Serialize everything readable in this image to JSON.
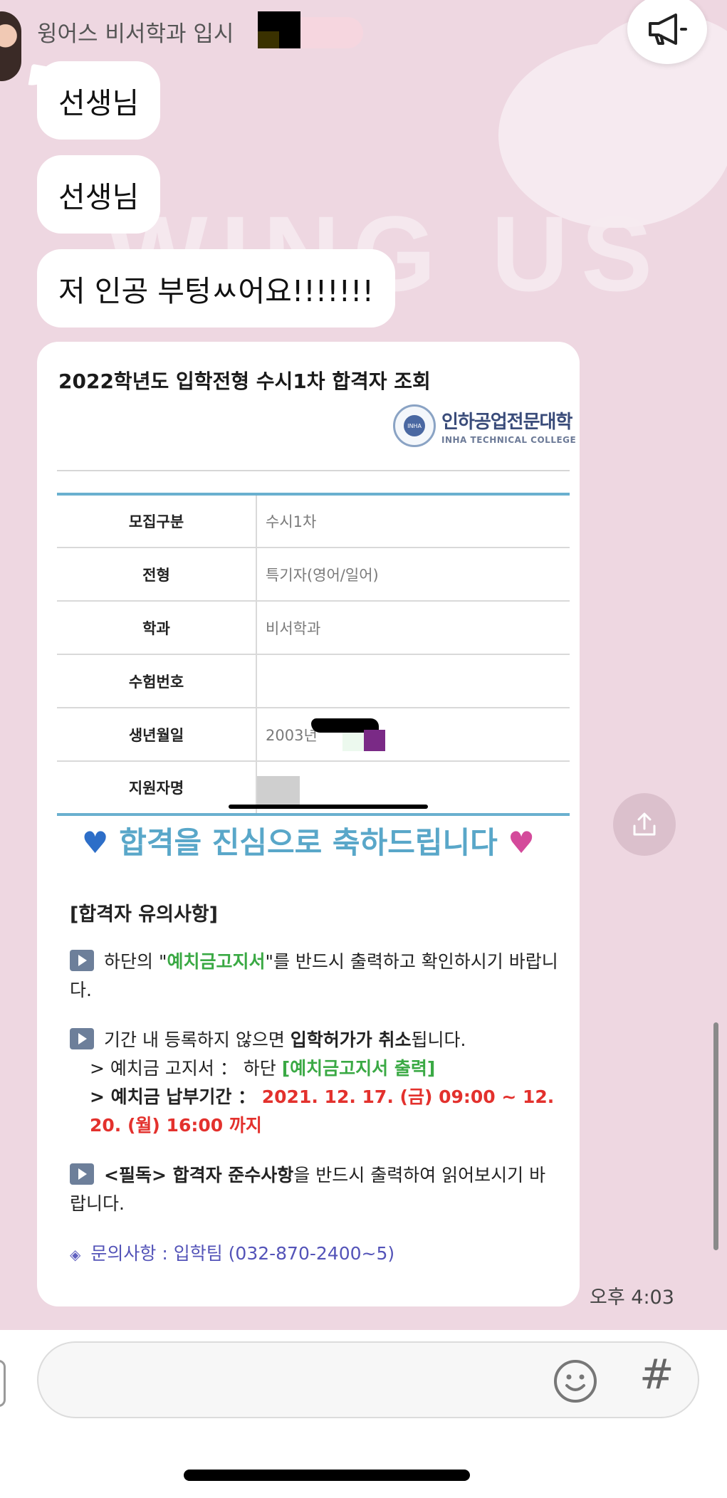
{
  "chat": {
    "sender_name": "윙어스 비서학과 입시",
    "messages": [
      "선생님",
      "선생님",
      "저 인공 부텅ㅆ어요!!!!!!!"
    ],
    "timestamp": "오후 4:03"
  },
  "background_text": "WING US",
  "card": {
    "title": "2022학년도 입학전형 수시1차 합격자 조회",
    "college_ko": "인하공업전문대학",
    "college_en": "INHA TECHNICAL COLLEGE",
    "seal_text": "INHA",
    "rows": [
      {
        "label": "모집구분",
        "value": "수시1차"
      },
      {
        "label": "전형",
        "value": "특기자(영어/일어)"
      },
      {
        "label": "학과",
        "value": "비서학과"
      },
      {
        "label": "수험번호",
        "value": ""
      },
      {
        "label": "생년월일",
        "value": "2003년"
      },
      {
        "label": "지원자명",
        "value": ""
      }
    ],
    "congrats": "합격을 진심으로 축하드립니다",
    "notes_title": "[합격자 유의사항]",
    "note1": {
      "a": "하단의 \"",
      "b": "예치금고지서",
      "c": "\"를 반드시 출력하고 확인하시기 바랍니다."
    },
    "note2": {
      "a": "기간 내 등록하지 않으면 ",
      "b": "입학허가가 취소",
      "c": "됩니다.",
      "sub1_a": "> 예치금 고지서 ： 하단 ",
      "sub1_b": "[예치금고지서 출력]",
      "sub2_a": "> 예치금 납부기간 ： ",
      "sub2_b": "2021. 12. 17. (금) 09:00 ~ 12. 20. (월) 16:00 까지"
    },
    "note3": {
      "a": "<필독> 합격자 준수사항",
      "b": "을 반드시 출력하여 읽어보시기 바랍니다."
    },
    "contact": "문의사항 : 입학팀 (032-870-2400~5)"
  },
  "input": {
    "placeholder": "",
    "hash": "#"
  },
  "icons": {
    "announce": "megaphone-icon",
    "share": "share-icon",
    "emoji": "smiley-icon"
  }
}
